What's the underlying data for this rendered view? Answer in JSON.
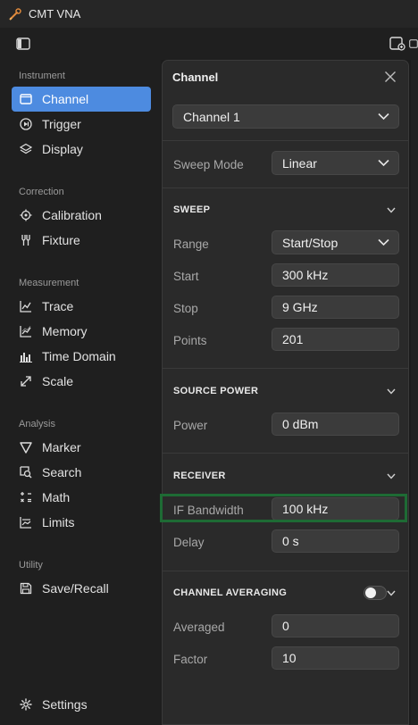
{
  "window": {
    "title": "CMT VNA"
  },
  "sidebar": {
    "sections": [
      {
        "label": "Instrument"
      },
      {
        "label": "Correction"
      },
      {
        "label": "Measurement"
      },
      {
        "label": "Analysis"
      },
      {
        "label": "Utility"
      }
    ],
    "items": [
      {
        "label": "Channel",
        "icon": "window-icon",
        "active": true
      },
      {
        "label": "Trigger",
        "icon": "trigger-icon"
      },
      {
        "label": "Display",
        "icon": "layers-icon"
      },
      {
        "label": "Calibration",
        "icon": "crosshair-icon"
      },
      {
        "label": "Fixture",
        "icon": "fixture-icon"
      },
      {
        "label": "Trace",
        "icon": "trace-icon"
      },
      {
        "label": "Memory",
        "icon": "memory-icon"
      },
      {
        "label": "Time Domain",
        "icon": "bar-chart-icon"
      },
      {
        "label": "Scale",
        "icon": "expand-icon"
      },
      {
        "label": "Marker",
        "icon": "marker-icon"
      },
      {
        "label": "Search",
        "icon": "search-icon"
      },
      {
        "label": "Math",
        "icon": "math-icon"
      },
      {
        "label": "Limits",
        "icon": "limits-icon"
      },
      {
        "label": "Save/Recall",
        "icon": "save-icon"
      },
      {
        "label": "Settings",
        "icon": "gear-icon"
      }
    ]
  },
  "panel": {
    "title": "Channel",
    "channel_select": "Channel 1",
    "sweep_mode": {
      "label": "Sweep Mode",
      "value": "Linear"
    },
    "sweep": {
      "heading": "SWEEP",
      "range": {
        "label": "Range",
        "value": "Start/Stop"
      },
      "start": {
        "label": "Start",
        "value": "300 kHz"
      },
      "stop": {
        "label": "Stop",
        "value": "9 GHz"
      },
      "points": {
        "label": "Points",
        "value": "201"
      }
    },
    "source_power": {
      "heading": "SOURCE POWER",
      "power": {
        "label": "Power",
        "value": "0 dBm"
      }
    },
    "receiver": {
      "heading": "RECEIVER",
      "if_bandwidth": {
        "label": "IF Bandwidth",
        "value": "100 kHz"
      },
      "delay": {
        "label": "Delay",
        "value": "0 s"
      }
    },
    "channel_averaging": {
      "heading": "CHANNEL AVERAGING",
      "enabled": false,
      "averaged": {
        "label": "Averaged",
        "value": "0"
      },
      "factor": {
        "label": "Factor",
        "value": "10"
      }
    }
  },
  "colors": {
    "accent": "#4d8be0",
    "highlight": "#1e6b34",
    "background": "#1c1c1c",
    "panel": "#2a2a2a"
  }
}
